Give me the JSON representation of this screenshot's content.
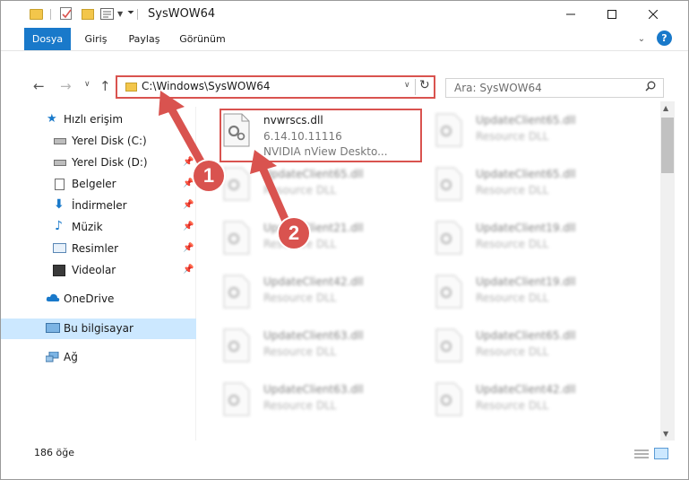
{
  "window": {
    "title": "SysWOW64"
  },
  "ribbon": {
    "tabs": [
      "Dosya",
      "Giriş",
      "Paylaş",
      "Görünüm"
    ],
    "help": "?"
  },
  "nav": {
    "address": "C:\\Windows\\SysWOW64",
    "search_placeholder": "Ara: SysWOW64"
  },
  "sidebar": {
    "items": [
      {
        "label": "Hızlı erişim",
        "icon": "star-icon"
      },
      {
        "label": "Yerel Disk (C:)",
        "icon": "drive-icon"
      },
      {
        "label": "Yerel Disk (D:)",
        "icon": "drive-icon"
      },
      {
        "label": "Belgeler",
        "icon": "documents-icon"
      },
      {
        "label": "İndirmeler",
        "icon": "download-icon"
      },
      {
        "label": "Müzik",
        "icon": "music-icon"
      },
      {
        "label": "Resimler",
        "icon": "pictures-icon"
      },
      {
        "label": "Videolar",
        "icon": "video-icon"
      },
      {
        "label": "OneDrive",
        "icon": "cloud-icon"
      },
      {
        "label": "Bu bilgisayar",
        "icon": "computer-icon"
      },
      {
        "label": "Ağ",
        "icon": "network-icon"
      }
    ]
  },
  "files": {
    "highlighted": {
      "name": "nvwrscs.dll",
      "version": "6.14.10.11116",
      "description": "NVIDIA nView Deskto..."
    },
    "left_column": [
      {
        "name": "UpdateClient65.dll",
        "type": "Resource DLL"
      },
      {
        "name": "UpdateClient21.dll",
        "type": "Resource DLL"
      },
      {
        "name": "UpdateClient42.dll",
        "type": "Resource DLL"
      },
      {
        "name": "UpdateClient63.dll",
        "type": "Resource DLL"
      },
      {
        "name": "UpdateClient63.dll",
        "type": "Resource DLL"
      }
    ],
    "right_column": [
      {
        "name": "UpdateClient65.dll",
        "type": "Resource DLL"
      },
      {
        "name": "UpdateClient65.dll",
        "type": "Resource DLL"
      },
      {
        "name": "UpdateClient19.dll",
        "type": "Resource DLL"
      },
      {
        "name": "UpdateClient19.dll",
        "type": "Resource DLL"
      },
      {
        "name": "UpdateClient65.dll",
        "type": "Resource DLL"
      },
      {
        "name": "UpdateClient42.dll",
        "type": "Resource DLL"
      }
    ]
  },
  "status": {
    "item_count": "186 öğe"
  },
  "annotations": {
    "step1": "1",
    "step2": "2",
    "color": "#d9534f"
  }
}
